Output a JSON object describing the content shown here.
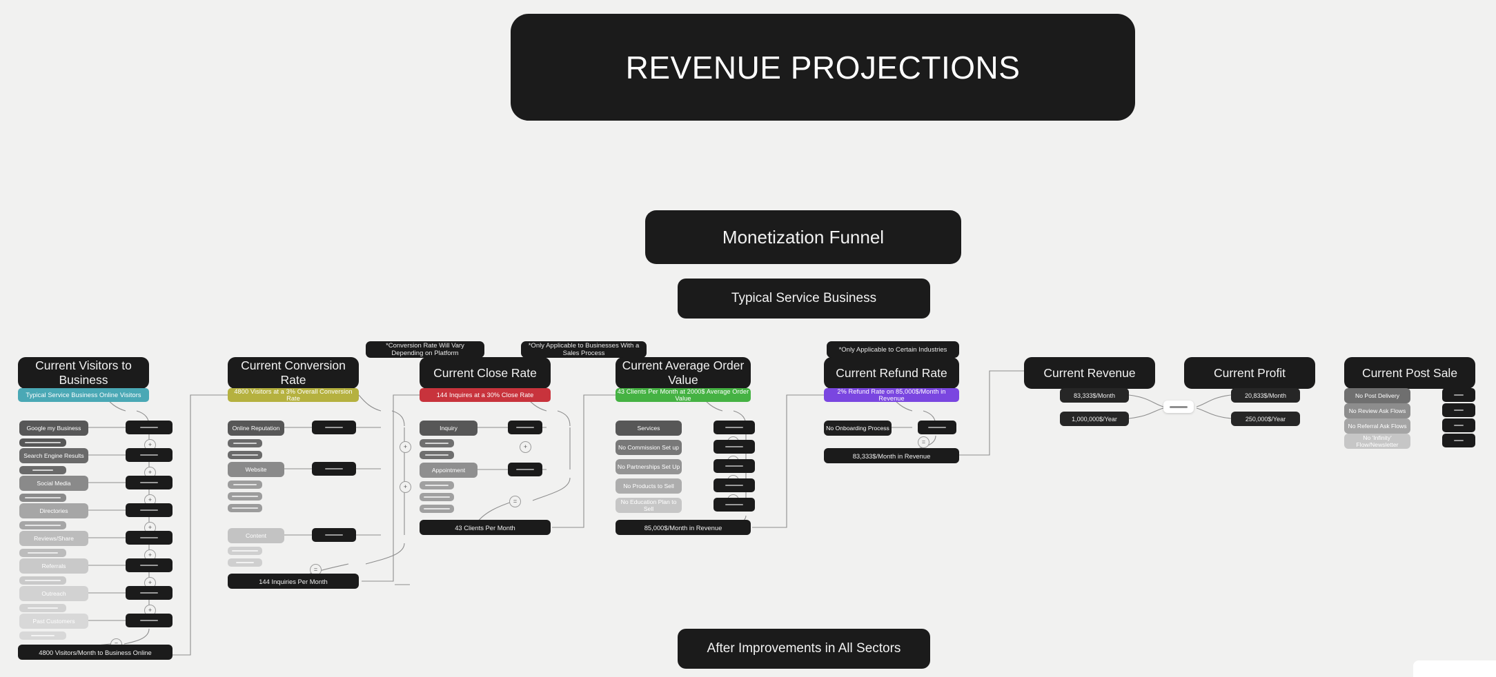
{
  "hero": {
    "title": "REVENUE PROJECTIONS"
  },
  "center": {
    "funnel": "Monetization Funnel",
    "typical": "Typical Service Business",
    "after": "After Improvements in All Sectors"
  },
  "notes": [
    {
      "text": "*Conversion Rate Will Vary Depending on Platform"
    },
    {
      "text": "*Only Applicable to Businesses With a Sales Process"
    },
    {
      "text": "*Only Applicable to Certain Industries"
    }
  ],
  "colors": {
    "background": "#f1f1f0",
    "dark": "#1b1b1b",
    "teal": "#4aa8b5",
    "olive": "#b5b13f",
    "red": "#c8333c",
    "green": "#45b243",
    "purple": "#7a46e0"
  },
  "columns": [
    {
      "id": "visitors",
      "heading": "Current Visitors to Business",
      "banner": "Typical Service Business Online Visitors",
      "banner_color": "teal",
      "items": [
        "Google my Business",
        "Search Engine Results",
        "Social Media",
        "Directories",
        "Reviews/Share",
        "Referrals",
        "Outreach",
        "Past Customers"
      ],
      "total": "4800 Visitors/Month to Business Online"
    },
    {
      "id": "conversion",
      "heading": "Current Conversion Rate",
      "banner": "4800 Visitors at a 3% Overall Conversion Rate",
      "banner_color": "olive",
      "items": [
        "Online Reputation",
        "Website",
        "Content"
      ],
      "total": "144 Inquiries Per Month"
    },
    {
      "id": "close",
      "heading": "Current Close Rate",
      "banner": "144 Inquires at a 30% Close Rate",
      "banner_color": "red",
      "items": [
        "Inquiry",
        "Appointment"
      ],
      "total": "43 Clients Per Month"
    },
    {
      "id": "aov",
      "heading": "Current Average Order Value",
      "banner": "43 Clients Per Month at 2000$ Average Order Value",
      "banner_color": "green",
      "items": [
        "Services",
        "No Commission Set up",
        "No Partnerships Set Up",
        "No Products to Sell",
        "No Education Plan to Sell"
      ],
      "total": "85,000$/Month in Revenue"
    },
    {
      "id": "refund",
      "heading": "Current Refund Rate",
      "banner": "2% Refund Rate on 85,000$/Month in Revenue",
      "banner_color": "purple",
      "items": [
        "No Onboarding Process"
      ],
      "total": "83,333$/Month in Revenue"
    }
  ],
  "revenue": {
    "heading": "Current Revenue",
    "values": [
      "83,333$/Month",
      "1,000,000$/Year"
    ]
  },
  "profit": {
    "heading": "Current Profit",
    "values": [
      "20,833$/Month",
      "250,000$/Year"
    ]
  },
  "post_sale": {
    "heading": "Current Post Sale",
    "items": [
      "No Post Delivery",
      "No Review Ask Flows",
      "No Referral Ask Flows",
      "No 'Infinity' Flow/Newsletter"
    ]
  },
  "operators": {
    "plus": "+",
    "equals": "="
  }
}
